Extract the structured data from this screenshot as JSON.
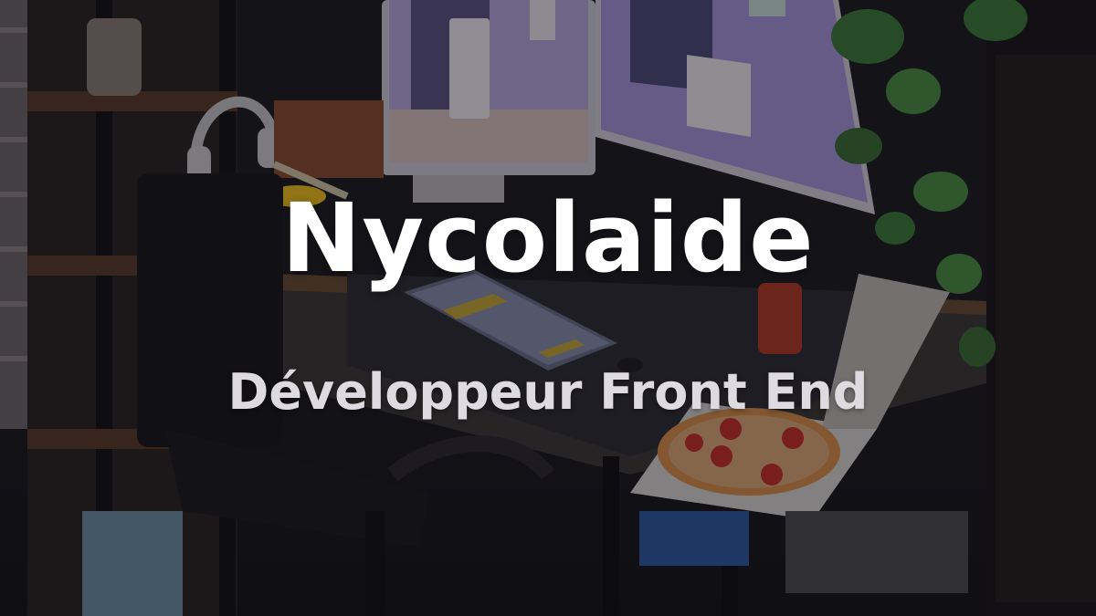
{
  "hero": {
    "title": "Nycolaide",
    "subtitle": "Développeur Front End"
  },
  "colors": {
    "title": "#ffffff",
    "subtitle": "#dedbe0",
    "monitor_screen": "#b9a9e4",
    "plant": "#3f7a3a",
    "pizza": "#d9904a",
    "lamp": "#f2c21b"
  },
  "illustration": {
    "description_icons": [
      "shelf-icon",
      "monitor-icon",
      "keyboard-icon",
      "plant-icon",
      "pizza-icon",
      "chair-icon",
      "headphones-icon",
      "lamp-icon"
    ]
  }
}
